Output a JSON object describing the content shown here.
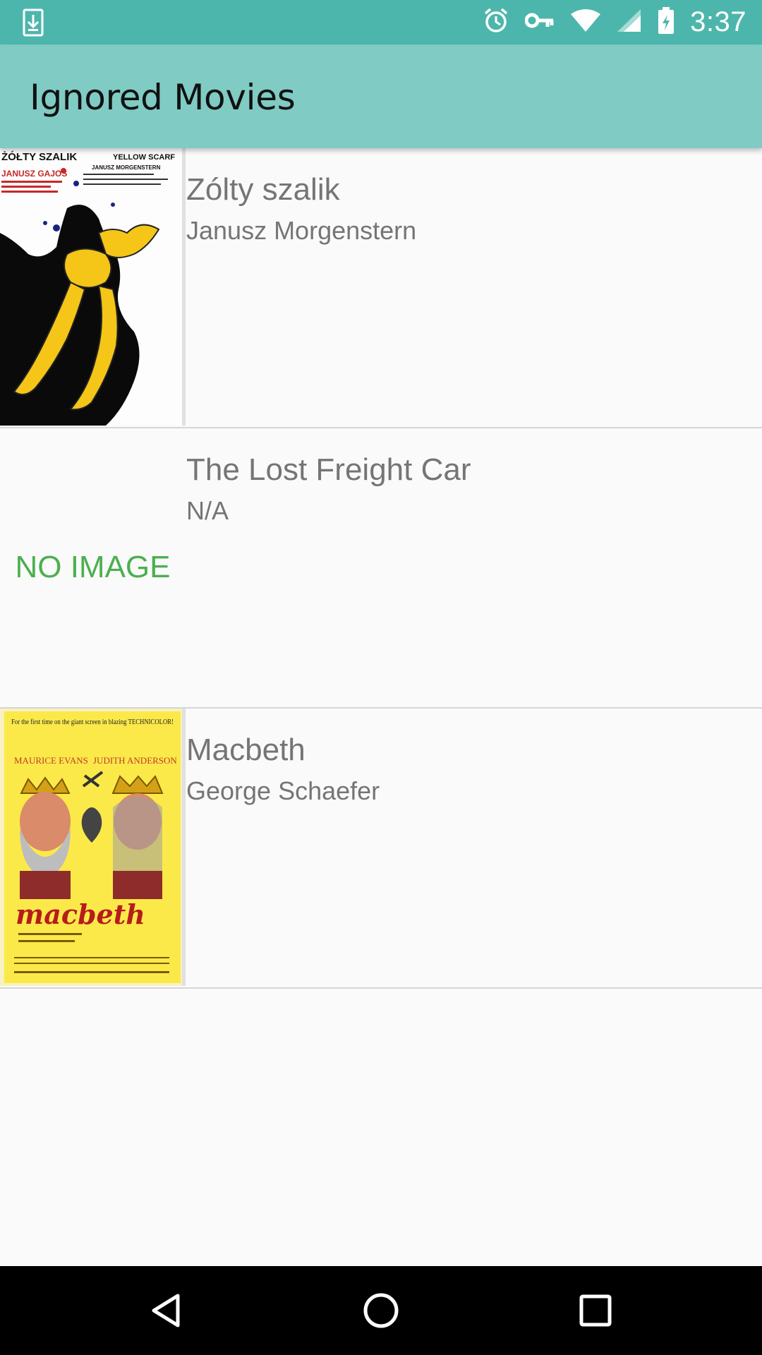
{
  "status_bar": {
    "time": "3:37",
    "icons": [
      "download-icon",
      "alarm-icon",
      "key-icon",
      "wifi-icon",
      "signal-icon",
      "battery-icon"
    ],
    "color": "#4db6ac"
  },
  "app_bar": {
    "title": "Ignored Movies",
    "color": "#80cbc4"
  },
  "movies": [
    {
      "title": "Zólty szalik",
      "director": "Janusz Morgenstern",
      "poster": "yellow-scarf-poster",
      "poster_text": {
        "line1": "ŻÓŁTY SZALIK",
        "line2": "YELLOW SCARF",
        "line3": "JANUSZ MORGENSTERN",
        "line4": "JANUSZ GAJOS"
      }
    },
    {
      "title": "The Lost Freight Car",
      "director": "N/A",
      "no_image_label": "NO IMAGE"
    },
    {
      "title": "Macbeth",
      "director": "George Schaefer",
      "poster": "macbeth-poster",
      "poster_text": {
        "top": "For the first time on the giant screen in blazing TECHNICOLOR!",
        "left_name": "MAURICE EVANS",
        "right_name": "JUDITH ANDERSON",
        "big": "macbeth"
      }
    }
  ],
  "colors": {
    "no_image": "#4caf50",
    "text_secondary": "#757575"
  },
  "nav_bar": {
    "buttons": [
      "back-icon",
      "home-icon",
      "recents-icon"
    ]
  }
}
